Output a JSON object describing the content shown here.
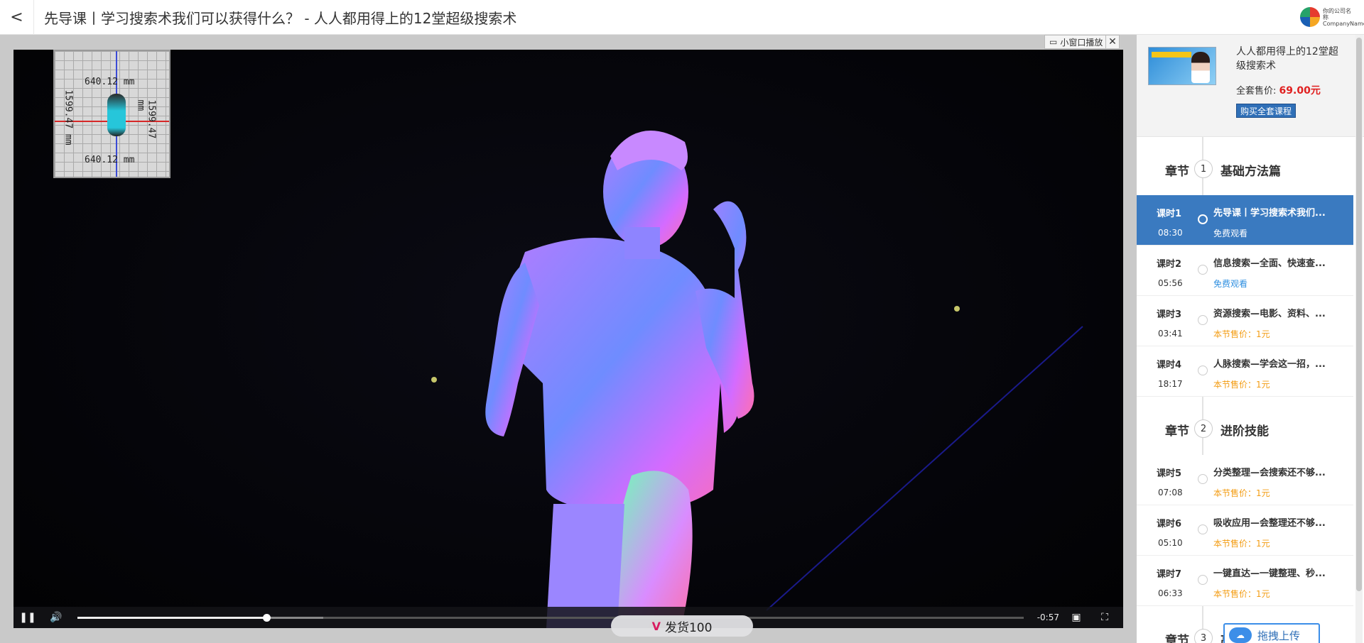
{
  "header": {
    "back_label": "<",
    "title": "先导课丨学习搜索术我们可以获得什么？ - 人人都用得上的12堂超级搜索术",
    "logo_text": "你的公司名称 CompanyName"
  },
  "player": {
    "mini_label": "小窗口播放",
    "close_label": "✕",
    "inset": {
      "top_label": "640.12 mm",
      "bottom_label": "640.12 mm",
      "left_label": "1599.47 mm",
      "right_label": "1599.47 mm"
    },
    "time_remaining": "-0:57",
    "progress_played": 0.2,
    "progress_buffered": 0.26,
    "ship_label": "发货100"
  },
  "course": {
    "title": "人人都用得上的12堂超级搜索术",
    "price_label": "全套售价:",
    "price_value": "69.00元",
    "buy_label": "购买全套课程"
  },
  "chapters": [
    {
      "label": "章节",
      "num": "1",
      "name": "基础方法篇",
      "lessons": [
        {
          "no": "课时1",
          "dur": "08:30",
          "name": "先导课丨学习搜索术我们...",
          "tag": "免费观看",
          "tag_type": "free",
          "active": true
        },
        {
          "no": "课时2",
          "dur": "05:56",
          "name": "信息搜索—全面、快速查...",
          "tag": "免费观看",
          "tag_type": "free",
          "active": false
        },
        {
          "no": "课时3",
          "dur": "03:41",
          "name": "资源搜索—电影、资料、...",
          "tag": "本节售价：1元",
          "tag_type": "paid",
          "active": false
        },
        {
          "no": "课时4",
          "dur": "18:17",
          "name": "人脉搜索—学会这一招，...",
          "tag": "本节售价：1元",
          "tag_type": "paid",
          "active": false
        }
      ]
    },
    {
      "label": "章节",
      "num": "2",
      "name": "进阶技能",
      "lessons": [
        {
          "no": "课时5",
          "dur": "07:08",
          "name": "分类整理—会搜索还不够...",
          "tag": "本节售价：1元",
          "tag_type": "paid",
          "active": false
        },
        {
          "no": "课时6",
          "dur": "05:10",
          "name": "吸收应用—会整理还不够...",
          "tag": "本节售价：1元",
          "tag_type": "paid",
          "active": false
        },
        {
          "no": "课时7",
          "dur": "06:33",
          "name": "一键直达—一键整理、秒...",
          "tag": "本节售价：1元",
          "tag_type": "paid",
          "active": false
        }
      ]
    },
    {
      "label": "章节",
      "num": "3",
      "name": "高",
      "lessons": []
    }
  ],
  "upload_label": "拖拽上传"
}
